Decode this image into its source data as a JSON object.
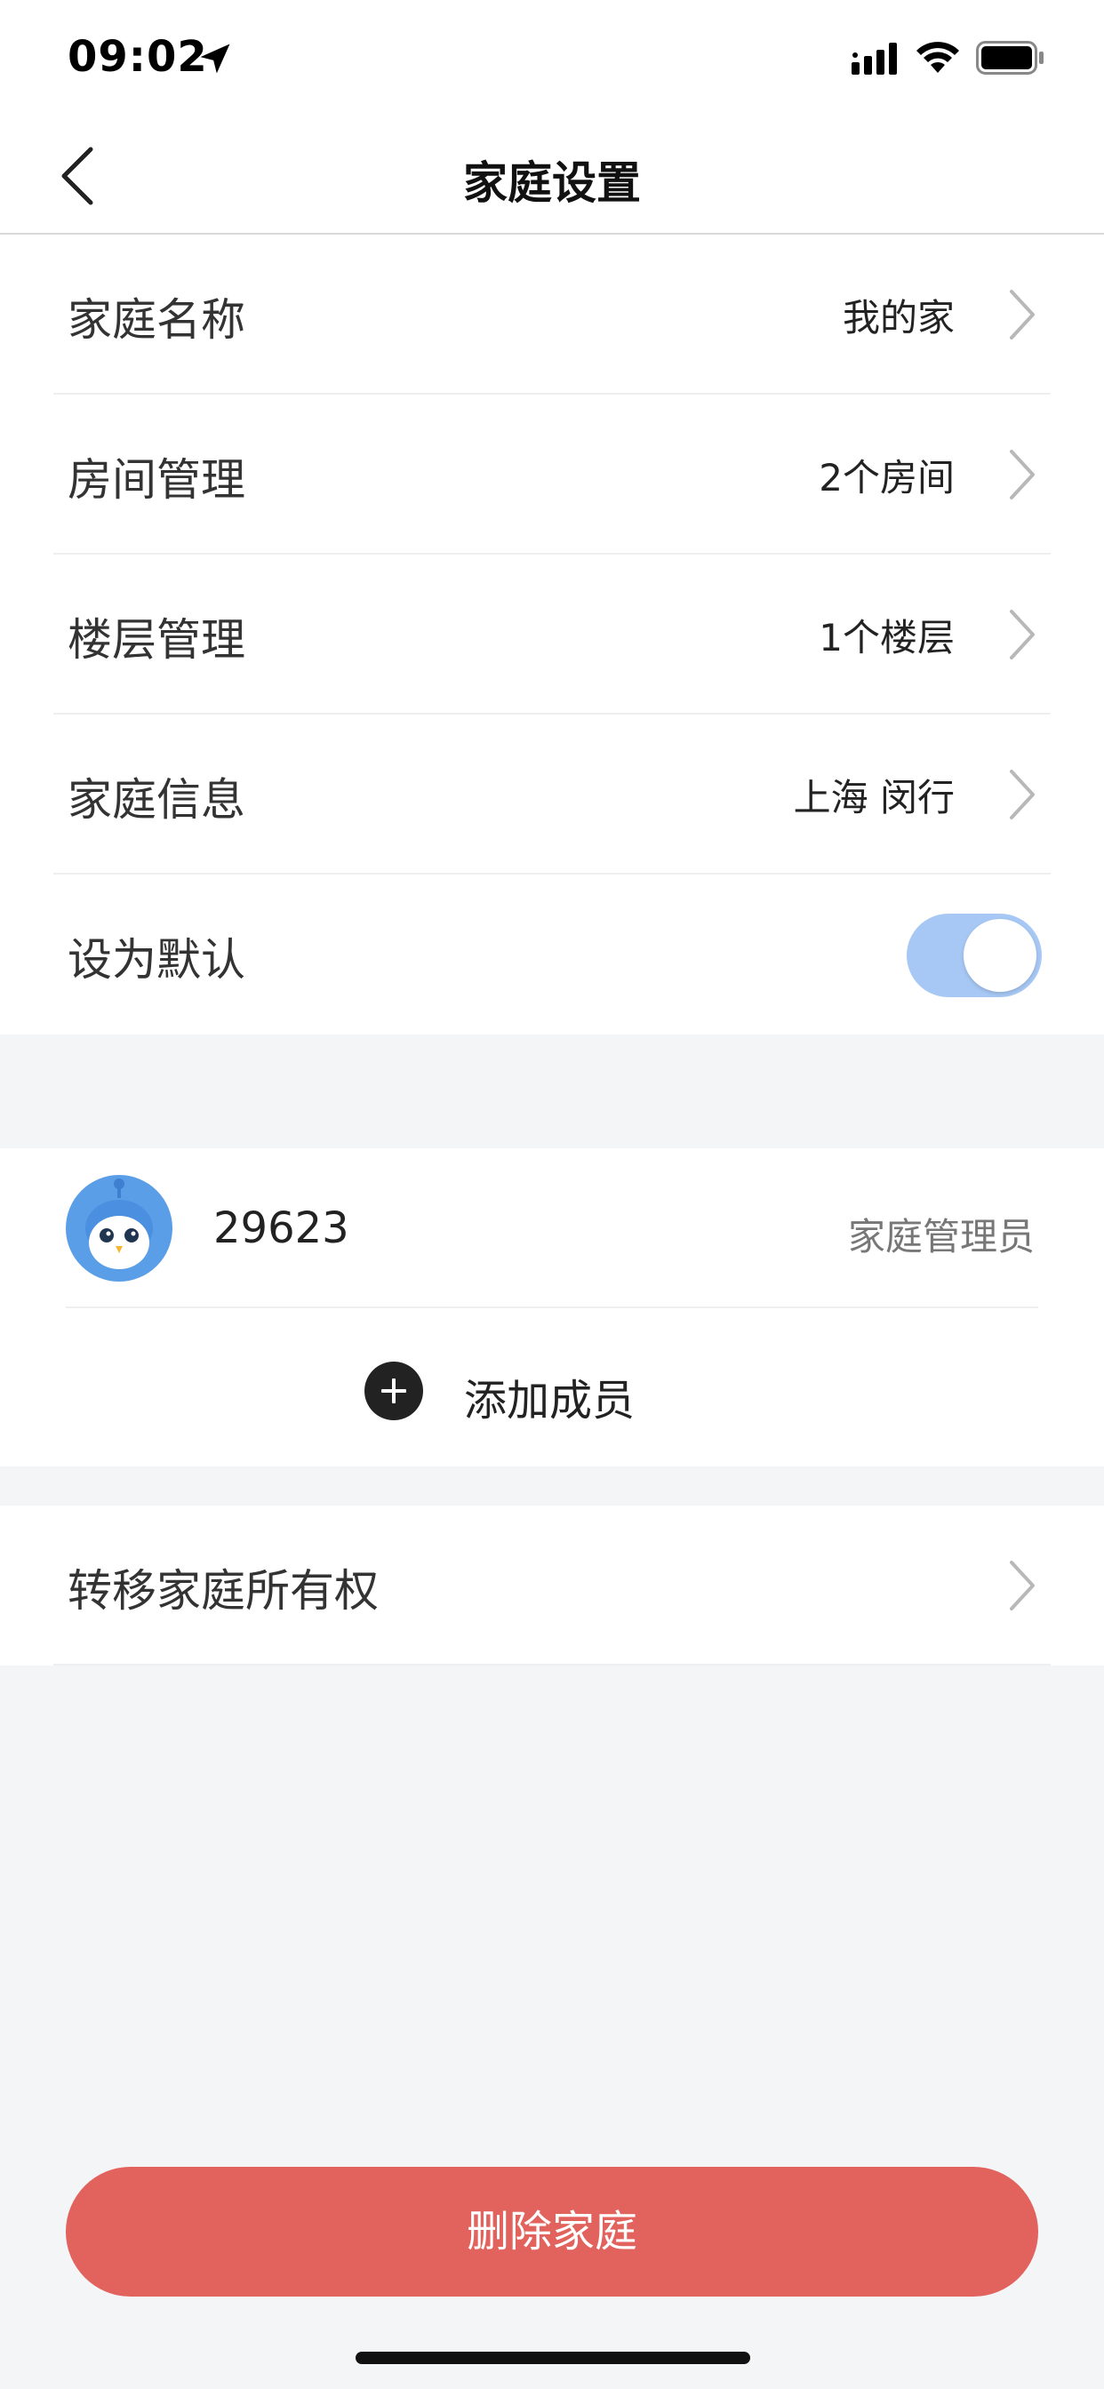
{
  "status_bar": {
    "time": "09:02",
    "icons": [
      "location-arrow-icon",
      "cellular-signal-icon",
      "wifi-icon",
      "battery-icon"
    ]
  },
  "nav": {
    "title": "家庭设置",
    "back_icon": "chevron-left-icon"
  },
  "settings": {
    "family_name": {
      "label": "家庭名称",
      "value": "我的家"
    },
    "room_management": {
      "label": "房间管理",
      "value": "2个房间"
    },
    "floor_management": {
      "label": "楼层管理",
      "value": "1个楼层"
    },
    "family_info": {
      "label": "家庭信息",
      "value": "上海 闵行"
    },
    "set_default": {
      "label": "设为默认",
      "enabled": true
    }
  },
  "members": {
    "list": [
      {
        "name": "29623",
        "role": "家庭管理员",
        "avatar_icon": "robot-avatar-icon"
      }
    ],
    "add_label": "添加成员"
  },
  "transfer": {
    "label": "转移家庭所有权"
  },
  "delete_label": "删除家庭",
  "colors": {
    "delete_button": "#e2625d",
    "toggle_on": "#a7c8f4",
    "background": "#f4f5f7"
  }
}
